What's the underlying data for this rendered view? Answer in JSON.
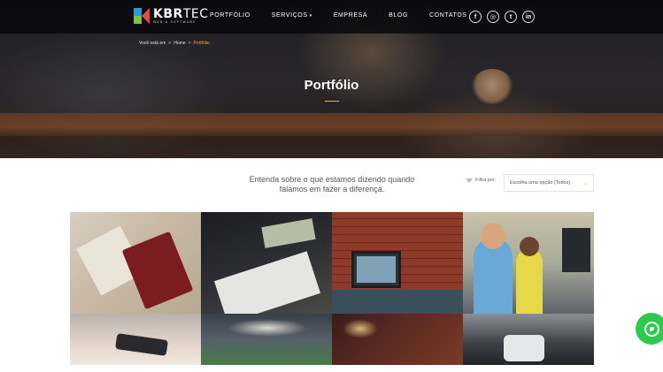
{
  "header": {
    "logo": {
      "brand_bold": "KBR",
      "brand_light": "TEC",
      "tagline": "WEB & SOFTWARE"
    },
    "nav": [
      {
        "label": "PORTFÓLIO"
      },
      {
        "label": "SERVIÇOS",
        "has_dropdown": true
      },
      {
        "label": "EMPRESA"
      },
      {
        "label": "BLOG"
      },
      {
        "label": "CONTATOS"
      }
    ],
    "social": [
      {
        "icon": "facebook-icon",
        "glyph": "f"
      },
      {
        "icon": "instagram-icon",
        "glyph": "◎"
      },
      {
        "icon": "twitter-icon",
        "glyph": "t"
      },
      {
        "icon": "linkedin-icon",
        "glyph": "in"
      }
    ]
  },
  "breadcrumb": {
    "prefix": "Você está em",
    "sep": ">",
    "home": "Home",
    "current": "Portfólio"
  },
  "hero": {
    "title": "Portfólio"
  },
  "filter": {
    "intro": "Entenda sobre o que estamos dizendo quando falamos em fazer a diferença.",
    "label": "Filtra por:",
    "select_value": "Escolha uma opção (Todos)",
    "chevron": "⌄"
  },
  "portfolio": {
    "tiles": [
      {
        "subject": "passport-on-map"
      },
      {
        "subject": "money-and-documents"
      },
      {
        "subject": "laptop-brick-wall"
      },
      {
        "subject": "kids-computers"
      },
      {
        "subject": "hand-smartphone"
      },
      {
        "subject": "stadium-crowd"
      },
      {
        "subject": "restaurant-table"
      },
      {
        "subject": "robot-toys"
      }
    ]
  },
  "colors": {
    "accent": "#f1b21a",
    "whatsapp": "#2ccb4c",
    "topbar": "#08080a"
  },
  "whatsapp": {
    "icon": "whatsapp-icon"
  }
}
